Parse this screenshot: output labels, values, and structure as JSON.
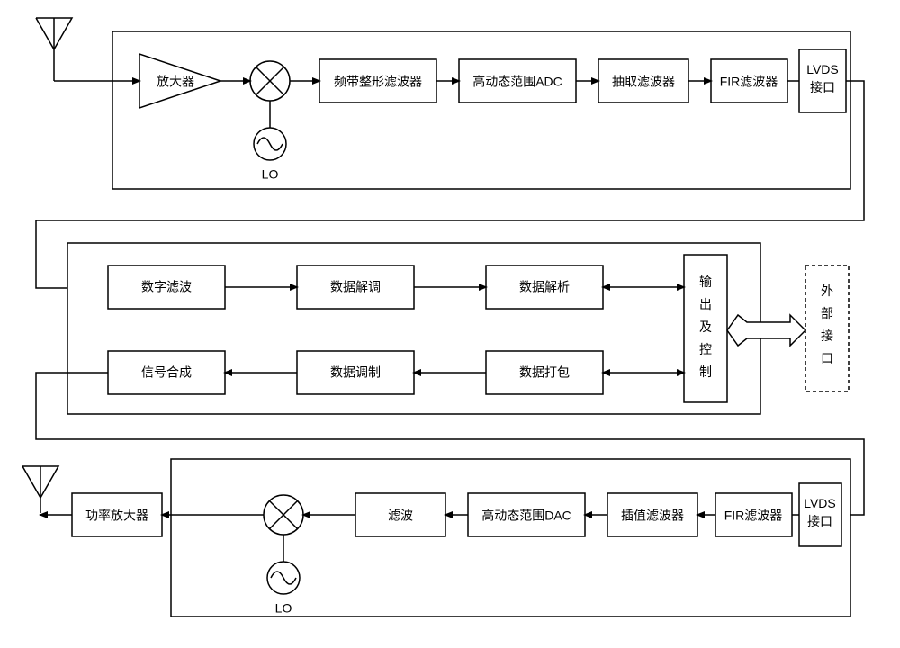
{
  "diagram": {
    "rx": {
      "amplifier": "放大器",
      "mixer_lo": "LO",
      "band_shape_filter": "频带整形滤波器",
      "high_dr_adc": "高动态范围ADC",
      "decimation_filter": "抽取滤波器",
      "fir_filter": "FIR滤波器",
      "lvds_if_1": "LVDS",
      "lvds_if_2": "接口"
    },
    "dsp": {
      "digital_filter": "数字滤波",
      "data_demod": "数据解调",
      "data_parse": "数据解析",
      "output_ctrl_1": "输",
      "output_ctrl_2": "出",
      "output_ctrl_3": "及",
      "output_ctrl_4": "控",
      "output_ctrl_5": "制",
      "ext_if_1": "外",
      "ext_if_2": "部",
      "ext_if_3": "接",
      "ext_if_4": "口",
      "signal_synth": "信号合成",
      "data_mod": "数据调制",
      "data_pack": "数据打包"
    },
    "tx": {
      "power_amp": "功率放大器",
      "mixer_lo": "LO",
      "filter": "滤波",
      "high_dr_dac": "高动态范围DAC",
      "interp_filter": "插值滤波器",
      "fir_filter": "FIR滤波器",
      "lvds_if_1": "LVDS",
      "lvds_if_2": "接口"
    }
  }
}
